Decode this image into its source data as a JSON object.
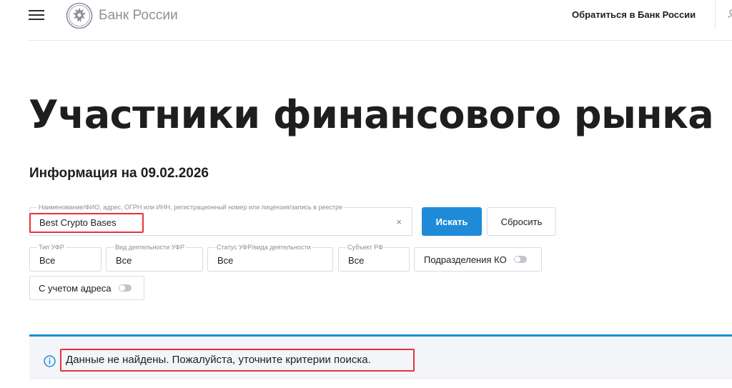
{
  "header": {
    "logo_text": "Банк России",
    "contact_link": "Обратиться в Банк России"
  },
  "page": {
    "title": "Участники финансового рынка",
    "info_date": "Информация на 09.02.2026"
  },
  "search": {
    "label": "Наименование/ФИО, адрес, ОГРН или ИНН, регистрационный номер или лицензия/запись в реестре",
    "value": "Best Crypto Bases",
    "clear_glyph": "×",
    "submit_label": "Искать",
    "reset_label": "Сбросить"
  },
  "filters": {
    "type": {
      "label": "Тип УФР",
      "value": "Все"
    },
    "activity": {
      "label": "Вид деятельности УФР",
      "value": "Все"
    },
    "status": {
      "label": "Статус УФР/вида деятельности",
      "value": "Все"
    },
    "region": {
      "label": "Субъект РФ",
      "value": "Все"
    },
    "branches_toggle": {
      "label": "Подразделения КО",
      "on": false
    },
    "address_toggle": {
      "label": "С учетом адреса",
      "on": false
    }
  },
  "result": {
    "message": "Данные не найдены. Пожалуйста, уточните критерии поиска."
  },
  "colors": {
    "accent": "#1f8bd8",
    "highlight": "#e8313b",
    "logo_gray": "#8b9099",
    "result_bg": "#f3f5f8"
  },
  "icons": {
    "menu": "hamburger-menu-icon",
    "logo": "bank-emblem-icon",
    "clear": "close-icon",
    "info": "info-circle-icon"
  }
}
